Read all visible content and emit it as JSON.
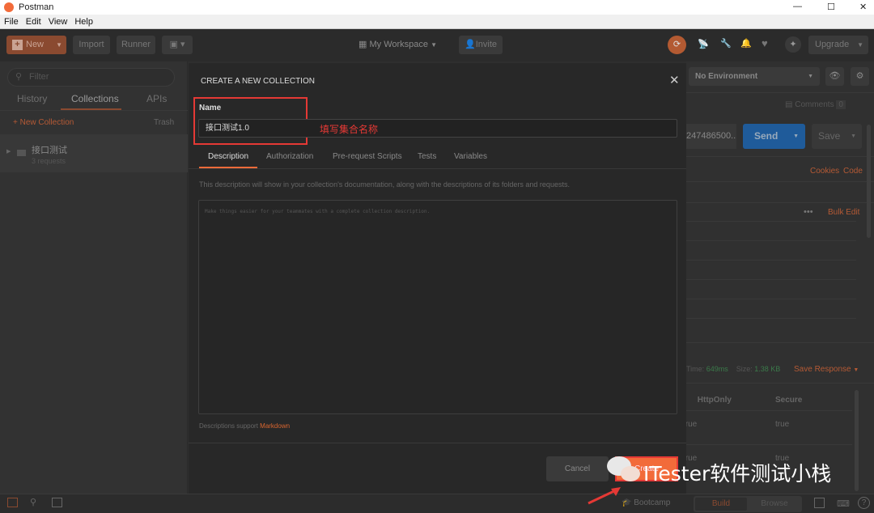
{
  "window": {
    "title": "Postman",
    "controls": [
      "—",
      "☐",
      "✕"
    ]
  },
  "menu": [
    "File",
    "Edit",
    "View",
    "Help"
  ],
  "toolbar": {
    "new": "New",
    "import": "Import",
    "runner": "Runner",
    "workspace": "My Workspace",
    "invite": "Invite",
    "upgrade": "Upgrade"
  },
  "sidebar": {
    "filter_placeholder": "Filter",
    "tabs": [
      "History",
      "Collections",
      "APIs"
    ],
    "new_collection": "+ New Collection",
    "trash": "Trash",
    "collections": [
      {
        "name": "接口测试",
        "meta": "3 requests"
      }
    ]
  },
  "modal": {
    "title": "CREATE A NEW COLLECTION",
    "name_label": "Name",
    "name_value": "接口测试1.0",
    "annotation": "填写集合名称",
    "tabs": [
      "Description",
      "Authorization",
      "Pre-request Scripts",
      "Tests",
      "Variables"
    ],
    "help": "This description will show in your collection's documentation, along with the descriptions of its folders and requests.",
    "desc_placeholder": "Make things easier for your teammates with a complete collection description.",
    "markdown_prefix": "Descriptions support",
    "markdown_link": "Markdown",
    "cancel": "Cancel",
    "create": "Create"
  },
  "right": {
    "environment": "No Environment",
    "comments": "Comments",
    "comments_count": "0",
    "url_tail": "247486500...",
    "send": "Send",
    "save": "Save",
    "cookies": "Cookies",
    "code": "Code",
    "bulk_edit": "Bulk Edit",
    "time_label": "Time:",
    "time": "649ms",
    "size_label": "Size:",
    "size": "1.38 KB",
    "save_response": "Save Response",
    "cols": [
      "HttpOnly",
      "Secure"
    ],
    "rows": [
      [
        "true",
        "true"
      ],
      [
        "true",
        "true"
      ]
    ]
  },
  "status": {
    "bootcamp": "Bootcamp",
    "build": "Build",
    "browse": "Browse"
  },
  "watermark": "ITester软件测试小栈",
  "colors": {
    "accent": "#f26b3a",
    "send": "#1f5b9a",
    "annotation": "#e53935"
  }
}
